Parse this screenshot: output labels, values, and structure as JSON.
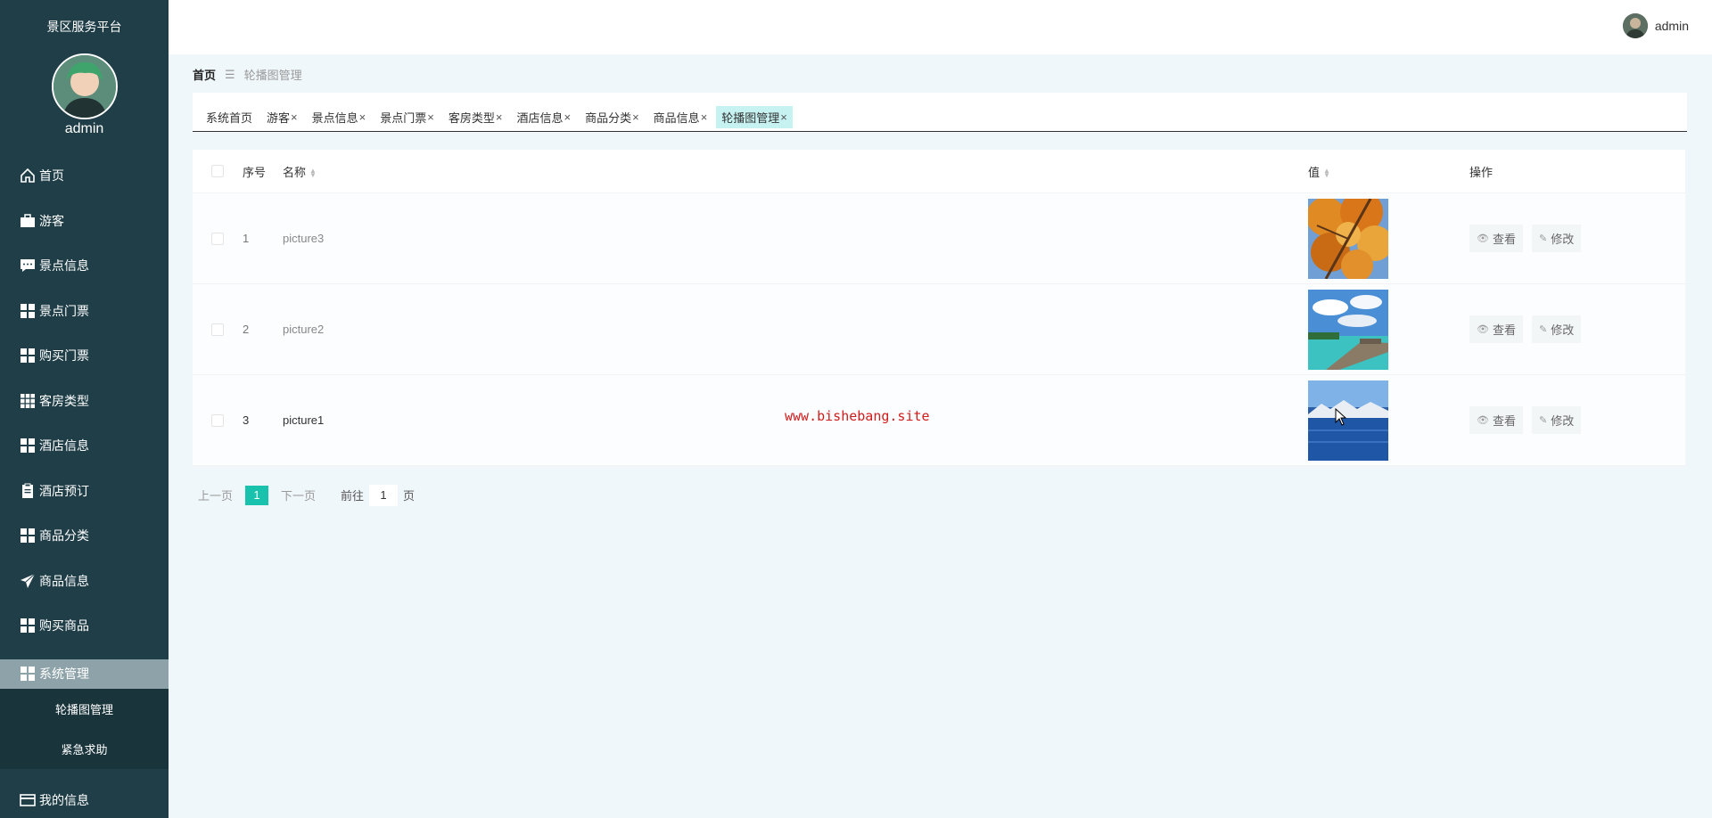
{
  "sidebar": {
    "title": "景区服务平台",
    "username": "admin",
    "items": [
      {
        "label": "首页",
        "icon": "home-icon"
      },
      {
        "label": "游客",
        "icon": "briefcase-icon"
      },
      {
        "label": "景点信息",
        "icon": "comment-icon"
      },
      {
        "label": "景点门票",
        "icon": "grid-icon"
      },
      {
        "label": "购买门票",
        "icon": "grid-icon"
      },
      {
        "label": "客房类型",
        "icon": "grid-nine-icon"
      },
      {
        "label": "酒店信息",
        "icon": "grid-icon"
      },
      {
        "label": "酒店预订",
        "icon": "clipboard-icon"
      },
      {
        "label": "商品分类",
        "icon": "grid-icon"
      },
      {
        "label": "商品信息",
        "icon": "send-icon"
      },
      {
        "label": "购买商品",
        "icon": "grid-icon"
      },
      {
        "label": "系统管理",
        "icon": "grid-icon"
      }
    ],
    "submenu": [
      "轮播图管理",
      "紧急求助"
    ],
    "my_info": "我的信息"
  },
  "header": {
    "username": "admin"
  },
  "breadcrumb": {
    "home": "首页",
    "current": "轮播图管理"
  },
  "tabs": [
    {
      "label": "系统首页",
      "closable": false
    },
    {
      "label": "游客",
      "closable": true
    },
    {
      "label": "景点信息",
      "closable": true
    },
    {
      "label": "景点门票",
      "closable": true
    },
    {
      "label": "客房类型",
      "closable": true
    },
    {
      "label": "酒店信息",
      "closable": true
    },
    {
      "label": "商品分类",
      "closable": true
    },
    {
      "label": "商品信息",
      "closable": true
    },
    {
      "label": "轮播图管理",
      "closable": true
    }
  ],
  "table": {
    "headers": {
      "index": "序号",
      "name": "名称",
      "value": "值",
      "actions": "操作"
    },
    "rows": [
      {
        "index": "1",
        "name": "picture3",
        "image": "autumn-tree"
      },
      {
        "index": "2",
        "name": "picture2",
        "image": "beach-pier"
      },
      {
        "index": "3",
        "name": "picture1",
        "image": "lake-mountains"
      }
    ],
    "view_label": "查看",
    "edit_label": "修改"
  },
  "pagination": {
    "prev": "上一页",
    "current": "1",
    "next": "下一页",
    "goto": "前往",
    "page_value": "1",
    "page_unit": "页"
  },
  "watermark": "www.bishebang.site",
  "colors": {
    "sidebar": "#1f3e47",
    "accent": "#19c2ac",
    "active_tab": "#c7f2f2"
  }
}
